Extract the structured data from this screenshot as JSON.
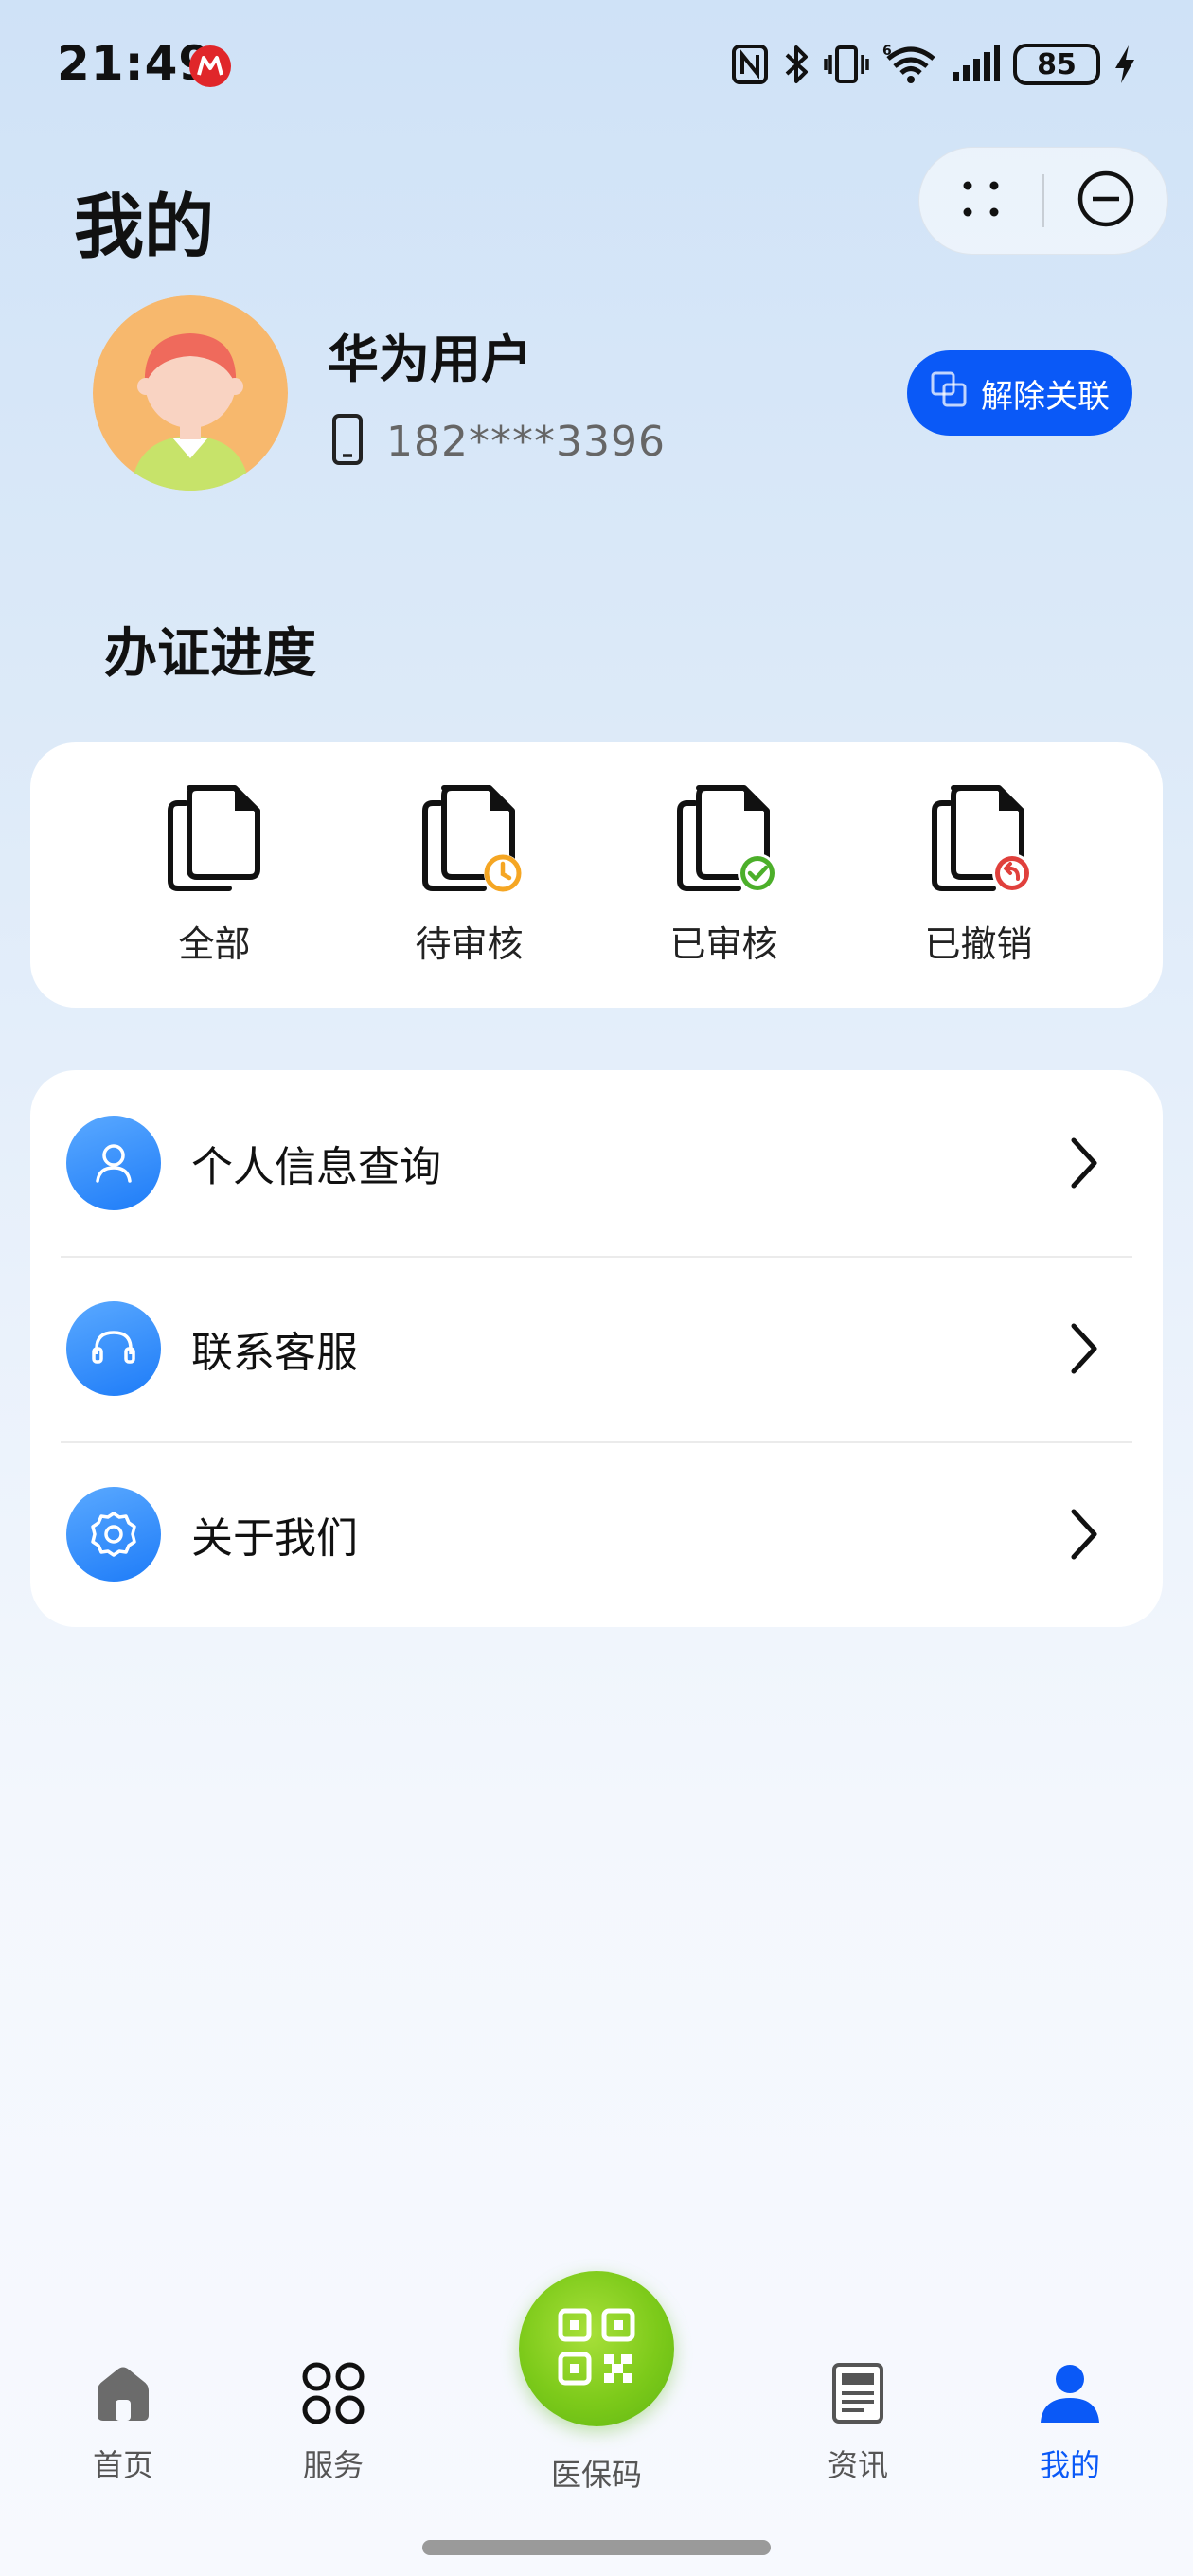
{
  "status_bar": {
    "time": "21:49",
    "app_icon": "metro-app-icon",
    "nfc_icon": "nfc-icon",
    "bluetooth_icon": "bluetooth-icon",
    "vibrate_icon": "vibrate-icon",
    "wifi_icon": "wifi-6-icon",
    "signal_icon": "signal-icon",
    "battery_level": "85",
    "charging_icon": "charging-icon"
  },
  "capsule": {
    "more_icon": "more-dots-icon",
    "close_icon": "minus-circle-icon"
  },
  "page_title": "我的",
  "profile": {
    "name": "华为用户",
    "phone": "182****3396",
    "phone_icon": "phone-icon",
    "unbind_label": "解除关联",
    "unbind_icon": "link-icon"
  },
  "progress": {
    "title": "办证进度",
    "items": [
      {
        "label": "全部",
        "icon": "document-icon"
      },
      {
        "label": "待审核",
        "icon": "document-pending-icon",
        "badge_color": "#f5a623"
      },
      {
        "label": "已审核",
        "icon": "document-approved-icon",
        "badge_color": "#4caf2a"
      },
      {
        "label": "已撤销",
        "icon": "document-revoked-icon",
        "badge_color": "#e0403c"
      }
    ]
  },
  "menu": {
    "items": [
      {
        "label": "个人信息查询",
        "icon": "user-icon"
      },
      {
        "label": "联系客服",
        "icon": "headset-icon"
      },
      {
        "label": "关于我们",
        "icon": "settings-icon"
      }
    ]
  },
  "tab_bar": {
    "items": [
      {
        "label": "首页",
        "icon": "home-icon",
        "active": false
      },
      {
        "label": "服务",
        "icon": "grid-icon",
        "active": false
      },
      {
        "label": "医保码",
        "icon": "qr-code-icon",
        "active": false
      },
      {
        "label": "资讯",
        "icon": "news-icon",
        "active": false
      },
      {
        "label": "我的",
        "icon": "profile-icon",
        "active": true
      }
    ]
  },
  "colors": {
    "accent": "#0a59f7",
    "qr_green": "#7dca1a",
    "menu_icon_blue": "#1e7cf8"
  }
}
